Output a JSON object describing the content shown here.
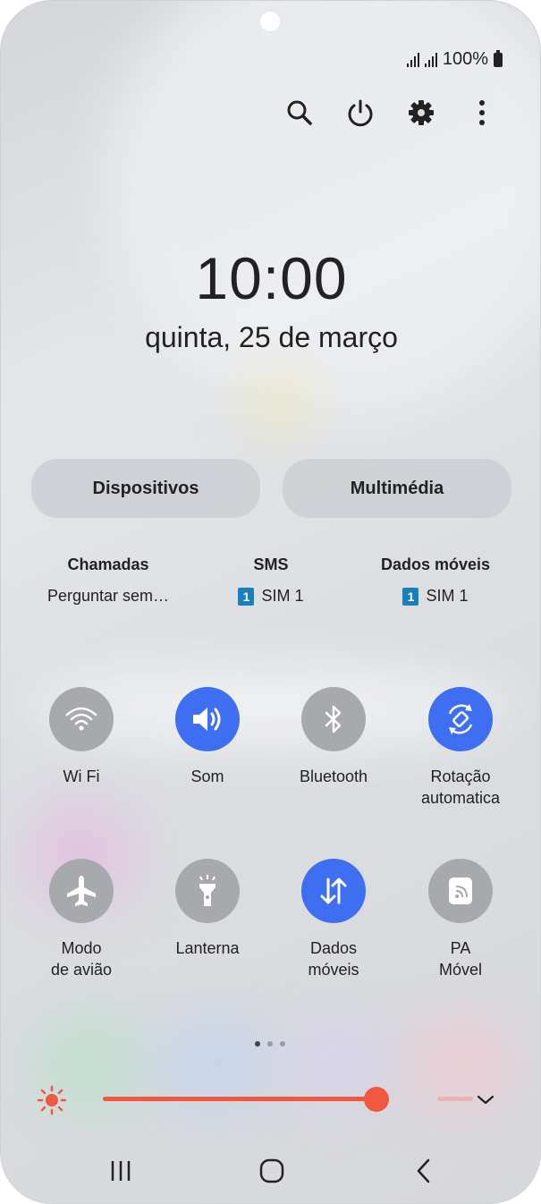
{
  "status_bar": {
    "battery": "100%"
  },
  "top_actions": [
    "search-icon",
    "power-icon",
    "settings-icon",
    "more-options-icon"
  ],
  "clock": {
    "time": "10:00",
    "date": "quinta, 25 de março"
  },
  "buttons": {
    "devices": "Dispositivos",
    "media": "Multimédia"
  },
  "sim": [
    {
      "title": "Chamadas",
      "value": "Perguntar sem…",
      "badge": ""
    },
    {
      "title": "SMS",
      "value": "SIM 1",
      "badge": "1"
    },
    {
      "title": "Dados móveis",
      "value": "SIM 1",
      "badge": "1"
    }
  ],
  "tiles": [
    {
      "icon": "wifi-icon",
      "line1": "Wi Fi",
      "line2": "",
      "active": false
    },
    {
      "icon": "sound-icon",
      "line1": "Som",
      "line2": "",
      "active": true
    },
    {
      "icon": "bluetooth-icon",
      "line1": "Bluetooth",
      "line2": "",
      "active": false
    },
    {
      "icon": "auto-rotate-icon",
      "line1": "Rotação",
      "line2": "automatica",
      "active": true
    },
    {
      "icon": "airplane-icon",
      "line1": "Modo",
      "line2": "de avião",
      "active": false
    },
    {
      "icon": "flashlight-icon",
      "line1": "Lanterna",
      "line2": "",
      "active": false
    },
    {
      "icon": "mobile-data-icon",
      "line1": "Dados",
      "line2": "móveis",
      "active": true
    },
    {
      "icon": "hotspot-icon",
      "line1": "PA",
      "line2": "Móvel",
      "active": false
    }
  ],
  "pager": {
    "pages": 3,
    "current": 1
  },
  "brightness": {
    "level": 0.88
  },
  "colors": {
    "active": "#3e6ff2",
    "inactive": "#a7a9ad",
    "brightness": "#f2583e"
  },
  "nav": [
    "recent-apps-icon",
    "home-icon",
    "back-icon"
  ]
}
